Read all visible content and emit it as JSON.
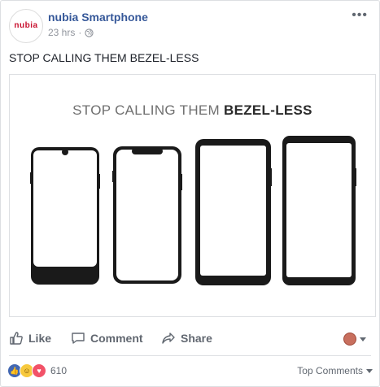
{
  "post": {
    "page_name": "nubia Smartphone",
    "timestamp": "23 hrs",
    "separator": "·",
    "caption": "STOP CALLING THEM BEZEL-LESS",
    "avatar_logo": "nubia"
  },
  "media": {
    "headline_light": "STOP CALLING THEM ",
    "headline_bold": "BEZEL-LESS"
  },
  "actions": {
    "like_label": "Like",
    "comment_label": "Comment",
    "share_label": "Share"
  },
  "footer": {
    "reaction_count": "610",
    "sort_label": "Top Comments"
  },
  "icons": {
    "more": "more-horizontal-icon",
    "globe": "globe-icon",
    "like": "thumbs-up-icon",
    "comment": "speech-bubble-icon",
    "share": "share-arrow-icon"
  }
}
